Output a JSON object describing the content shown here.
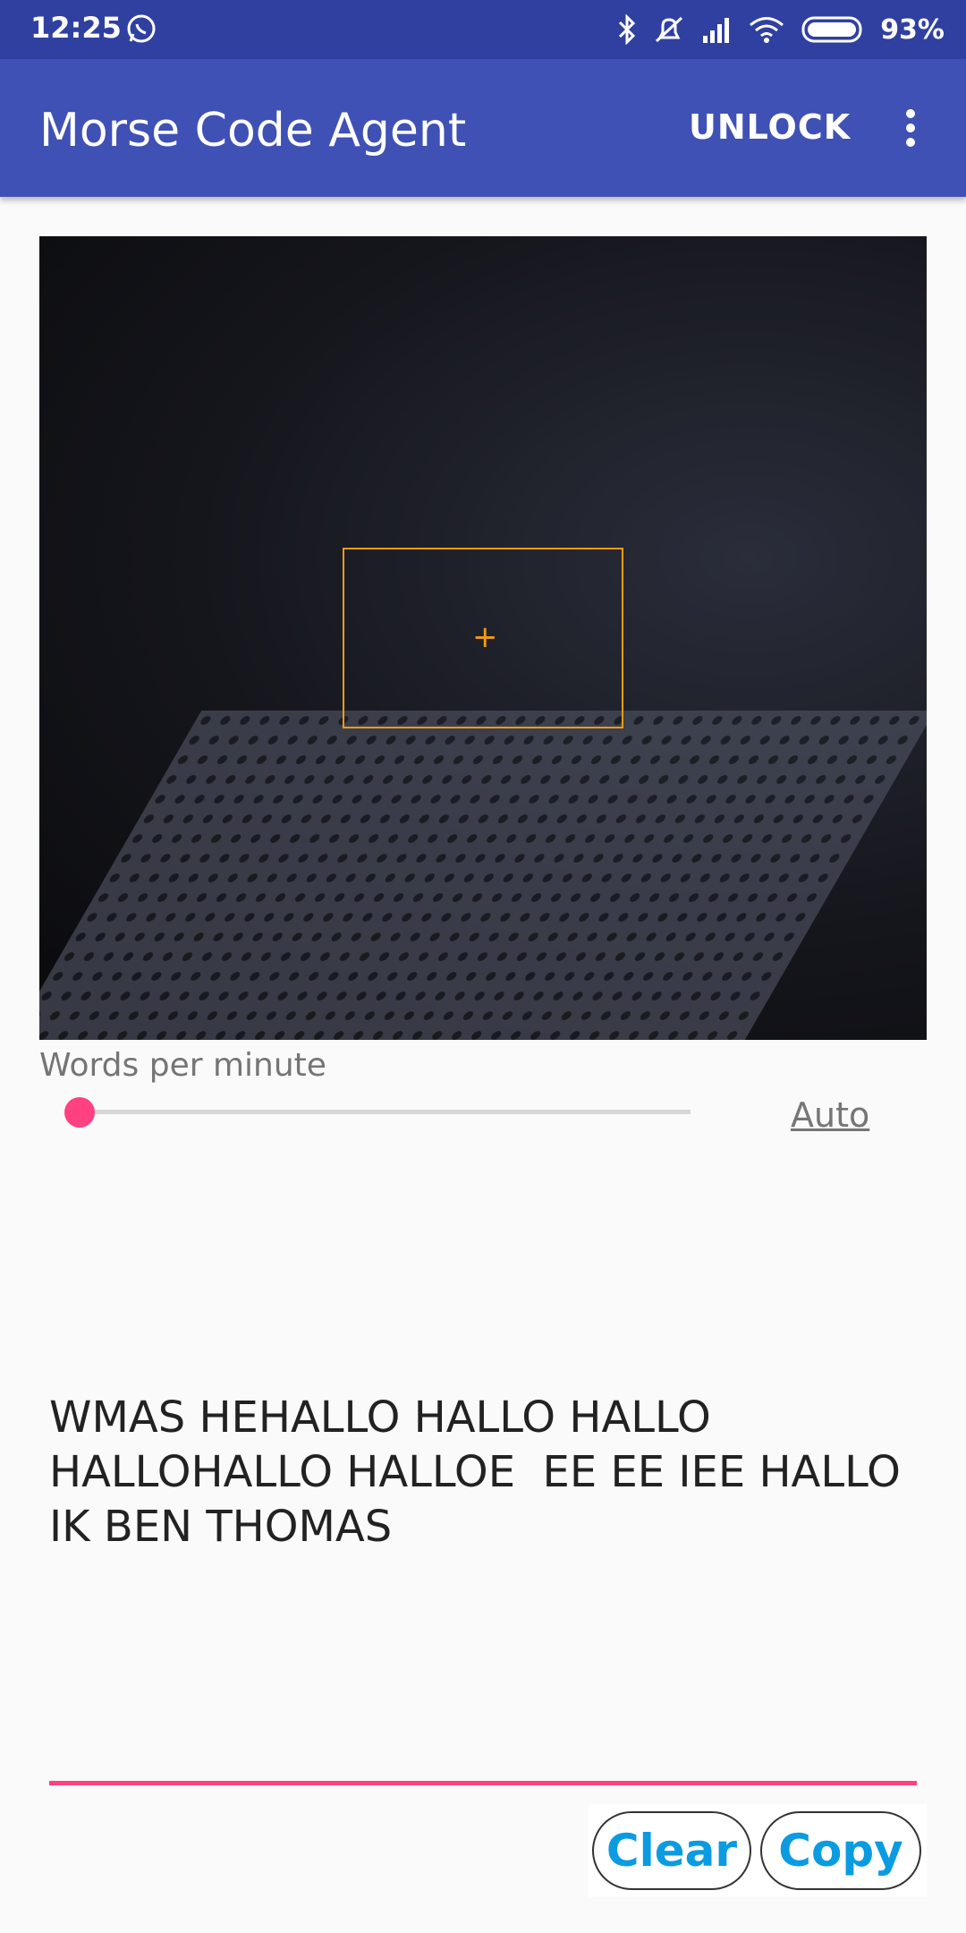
{
  "status_bar": {
    "time": "12:25",
    "battery": "93%"
  },
  "app_bar": {
    "title": "Morse Code Agent",
    "unlock_label": "UNLOCK"
  },
  "camera": {
    "focus_marker": "+"
  },
  "wpm": {
    "label": "Words per minute",
    "slider_value": 0,
    "auto_label": "Auto"
  },
  "output": {
    "text": "WMAS HEHALLO HALLO HALLO\nHALLOHALLO HALLOE  EE EE IEE HALLO\nIK BEN THOMAS"
  },
  "actions": {
    "clear_label": "Clear",
    "copy_label": "Copy"
  },
  "colors": {
    "status_bar": "#3040a0",
    "app_bar": "#3f51b5",
    "accent": "#ff4081",
    "focus_box": "#f29b16",
    "button_text": "#0b9be0"
  }
}
